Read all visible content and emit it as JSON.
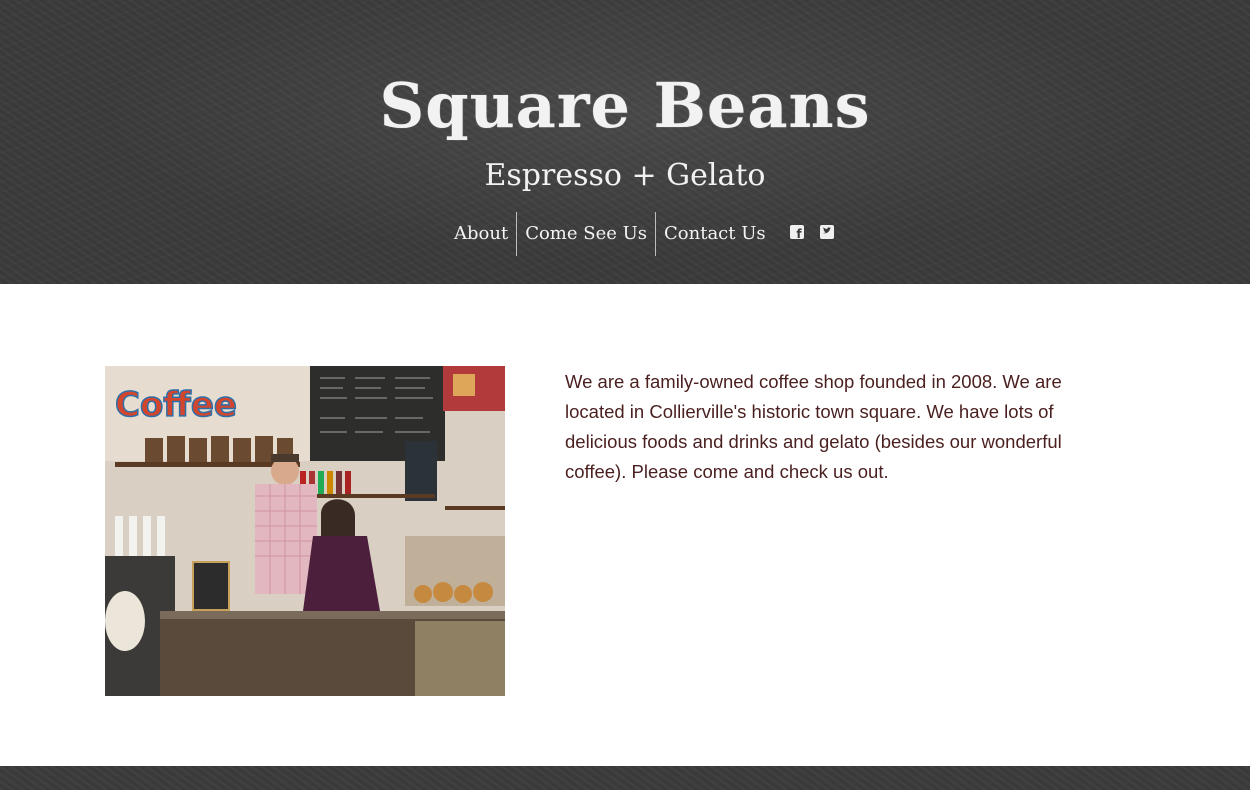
{
  "header": {
    "title": "Square Beans",
    "tagline": "Espresso + Gelato"
  },
  "nav": {
    "items": [
      {
        "label": "About"
      },
      {
        "label": "Come See Us"
      },
      {
        "label": "Contact Us"
      }
    ],
    "social": [
      "facebook-icon",
      "twitter-icon"
    ]
  },
  "main": {
    "photo": {
      "sign_text": "Coffee"
    },
    "about": "We are a family-owned coffee shop founded in 2008. We are located in Collierville's historic town square. We have lots of delicious foods and drinks and gelato (besides our wonderful coffee). Please come and check us out."
  },
  "colors": {
    "header_bg": "#3a3a3a",
    "body_text": "#4a1f1f",
    "header_text": "#f2f2f2"
  }
}
